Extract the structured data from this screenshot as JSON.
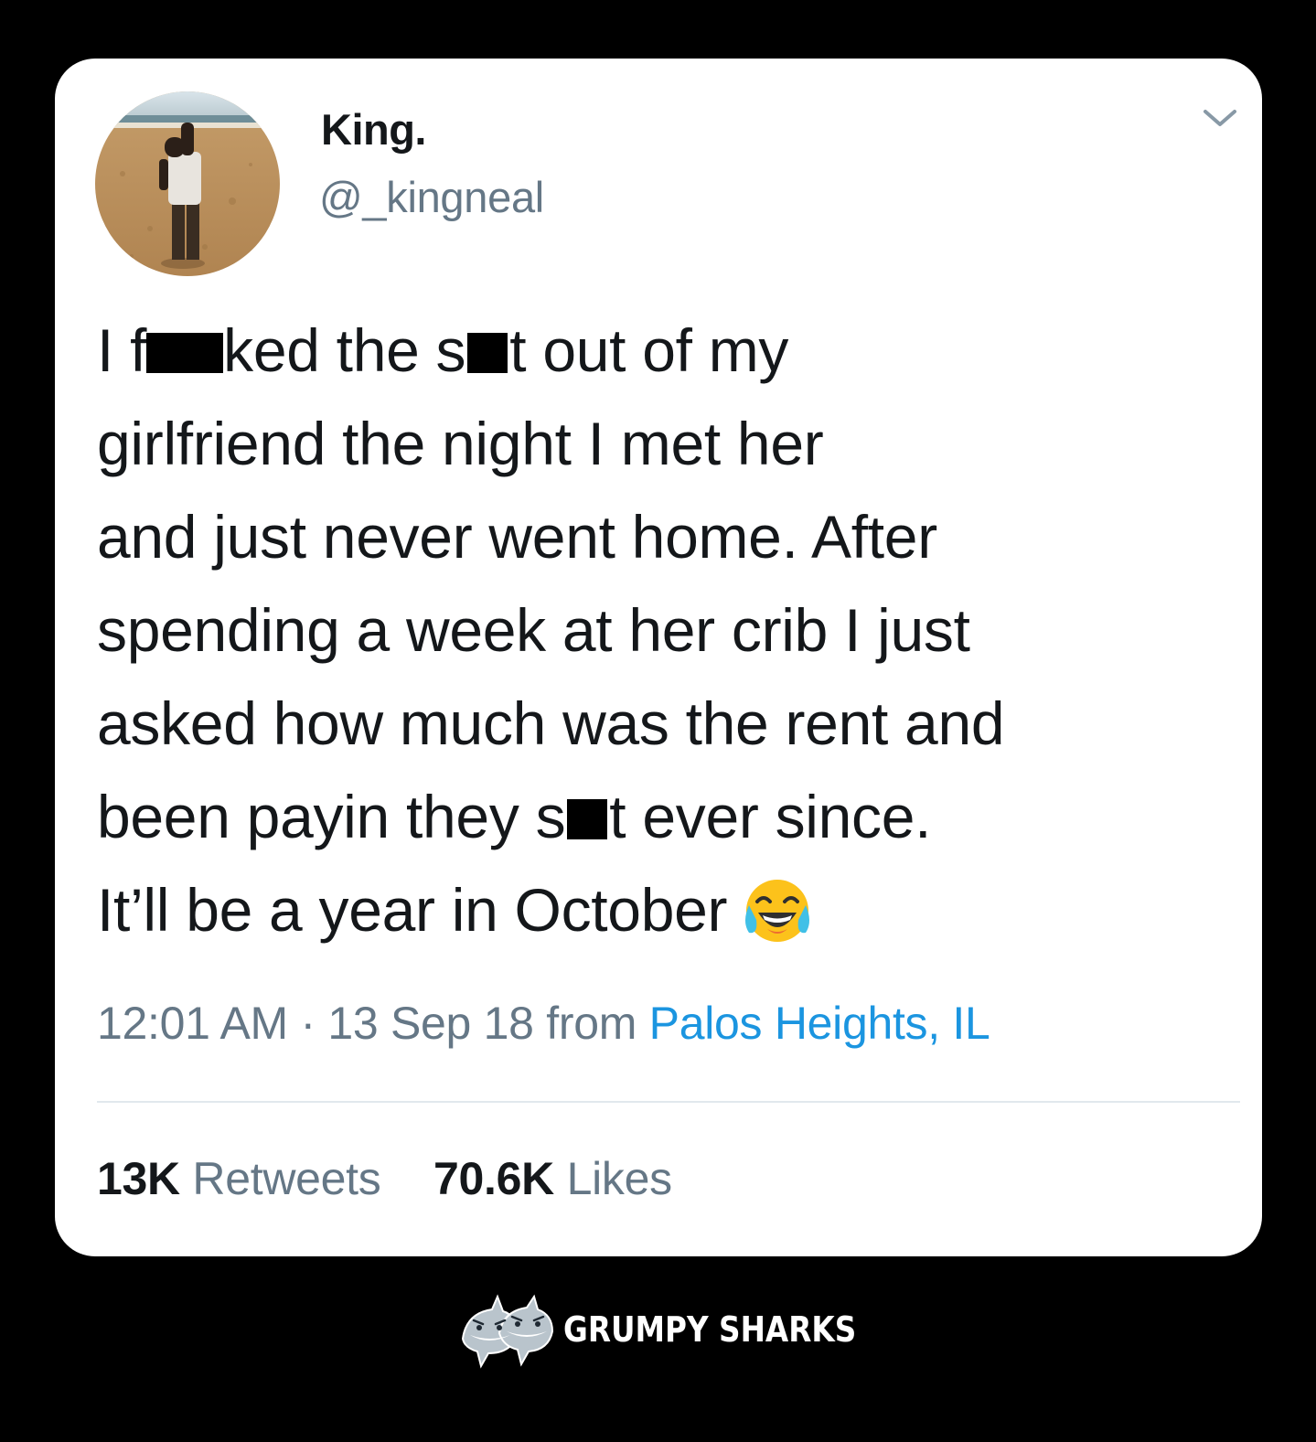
{
  "tweet": {
    "author": {
      "display_name": "King.",
      "handle": "@_kingneal"
    },
    "text_lines": [
      [
        "I f",
        "[censored]",
        "ked the s",
        "[censored]",
        "t out of my"
      ],
      [
        "girlfriend the night I met her"
      ],
      [
        "and just never went home. After"
      ],
      [
        "spending a week at her crib I just"
      ],
      [
        "asked how much was the rent and"
      ],
      [
        "been payin they s",
        "[censored]",
        "t ever since."
      ],
      [
        "It’ll be a year in October"
      ]
    ],
    "emoji": "face-with-tears-of-joy",
    "timestamp": "12:01 AM · 13 Sep 18 from",
    "location": "Palos Heights, IL",
    "stats": {
      "retweets_count": "13K",
      "retweets_label": "Retweets",
      "likes_count": "70.6K",
      "likes_label": "Likes"
    }
  },
  "watermark": {
    "text": "GRUMPY SHARKS"
  },
  "colors": {
    "background": "#000000",
    "card": "#ffffff",
    "text_primary": "#14171a",
    "text_secondary": "#657786",
    "link": "#1b95e0",
    "divider": "#e1e8ed"
  }
}
